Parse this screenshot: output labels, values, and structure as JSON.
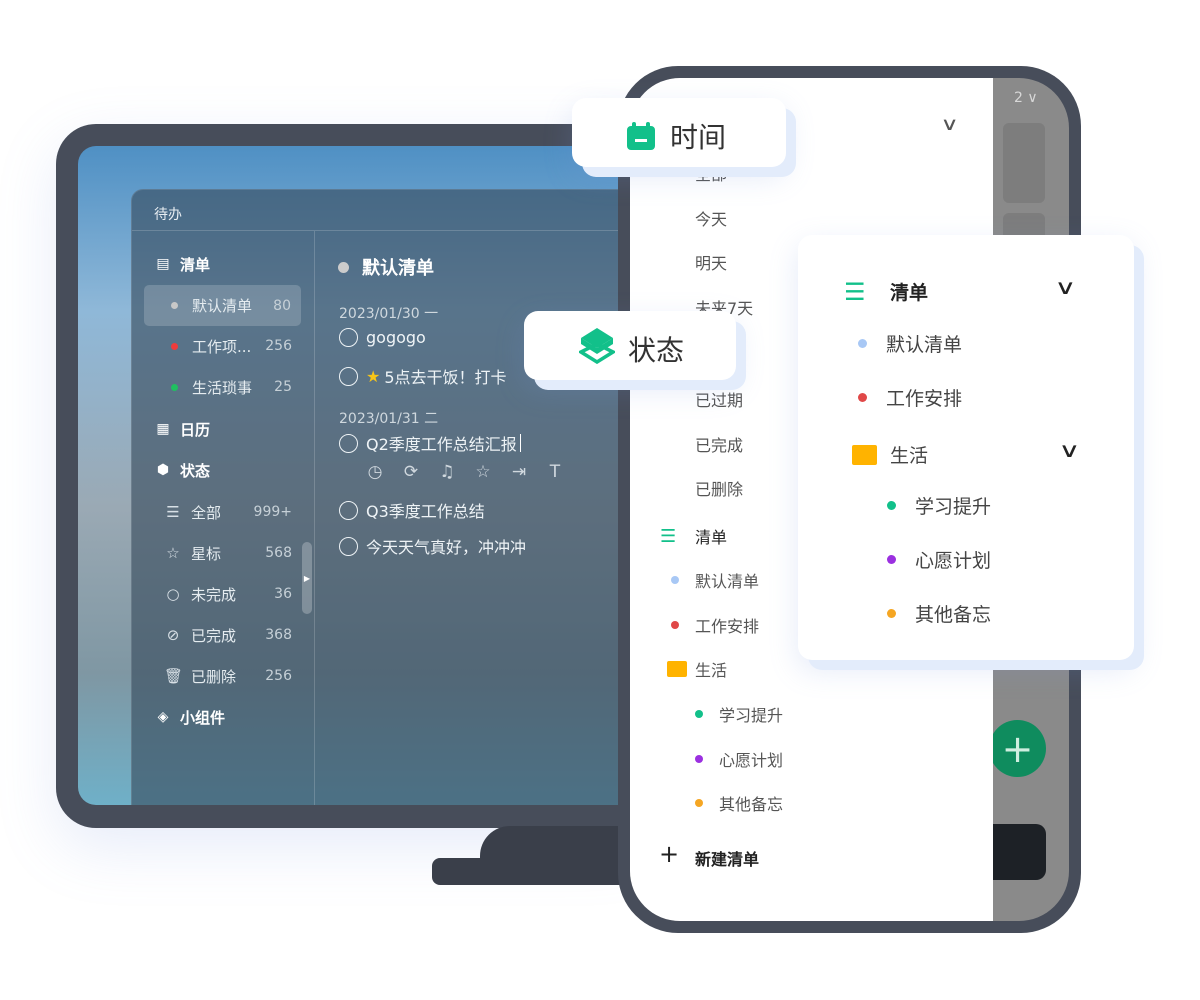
{
  "colors": {
    "accent": "#12c08a",
    "red": "#e04848",
    "green": "#20c060",
    "purple": "#9b30e0",
    "orange": "#f5a623",
    "blue": "#a8c8f5",
    "folder": "#ffb300",
    "frame": "#474d5a"
  },
  "desktop": {
    "window_title": "待办",
    "sidebar": {
      "lists_header": {
        "label": "清单",
        "icon": "list-icon"
      },
      "lists": [
        {
          "label": "默认清单",
          "count": "80",
          "color": "#c8c8c8",
          "selected": true
        },
        {
          "label": "工作项...",
          "count": "256",
          "color": "#f03c3c"
        },
        {
          "label": "生活琐事",
          "count": "25",
          "color": "#20c060"
        }
      ],
      "calendar": {
        "label": "日历",
        "icon": "calendar-icon"
      },
      "status_header": {
        "label": "状态",
        "icon": "cube-icon"
      },
      "status": [
        {
          "label": "全部",
          "count": "999+",
          "icon": "list-bullet-icon"
        },
        {
          "label": "星标",
          "count": "568",
          "icon": "star-icon"
        },
        {
          "label": "未完成",
          "count": "36",
          "icon": "circle-icon"
        },
        {
          "label": "已完成",
          "count": "368",
          "icon": "check-circle-icon"
        },
        {
          "label": "已删除",
          "count": "256",
          "icon": "trash-icon"
        }
      ],
      "widgets": {
        "label": "小组件",
        "icon": "layers-icon"
      }
    },
    "main": {
      "title": "默认清单",
      "groups": [
        {
          "date": "2023/01/30 一",
          "tasks": [
            "gogogo",
            "5点去干饭！打卡"
          ]
        },
        {
          "date": "2023/01/31 二",
          "tasks": [
            "Q2季度工作总结汇报",
            "Q3季度工作总结",
            "今天天气真好，冲冲冲"
          ]
        }
      ],
      "task_toolbar": [
        "clock-icon",
        "repeat-icon",
        "bell-icon",
        "star-icon",
        "move-icon",
        "text-icon"
      ]
    }
  },
  "phone": {
    "time_items": [
      "全部",
      "今天",
      "明天",
      "未来7天"
    ],
    "status_items": [
      "已过期",
      "已完成",
      "已删除"
    ],
    "lists_header": "清单",
    "lists": [
      {
        "label": "默认清单",
        "color": "#a8c8f5"
      },
      {
        "label": "工作安排",
        "color": "#e04848"
      }
    ],
    "folder": "生活",
    "folder_items": [
      {
        "label": "学习提升",
        "color": "#12c08a"
      },
      {
        "label": "心愿计划",
        "color": "#9b30e0"
      },
      {
        "label": "其他备忘",
        "color": "#f5a623"
      }
    ],
    "new_list": "新建清单",
    "badge": "2"
  },
  "callouts": {
    "time": "时间",
    "status": "状态",
    "lists": {
      "header": "清单",
      "items": [
        {
          "label": "默认清单",
          "color": "#a8c8f5"
        },
        {
          "label": "工作安排",
          "color": "#e04848"
        }
      ],
      "folder": "生活",
      "folder_items": [
        {
          "label": "学习提升",
          "color": "#12c08a"
        },
        {
          "label": "心愿计划",
          "color": "#9b30e0"
        },
        {
          "label": "其他备忘",
          "color": "#f5a623"
        }
      ]
    }
  }
}
